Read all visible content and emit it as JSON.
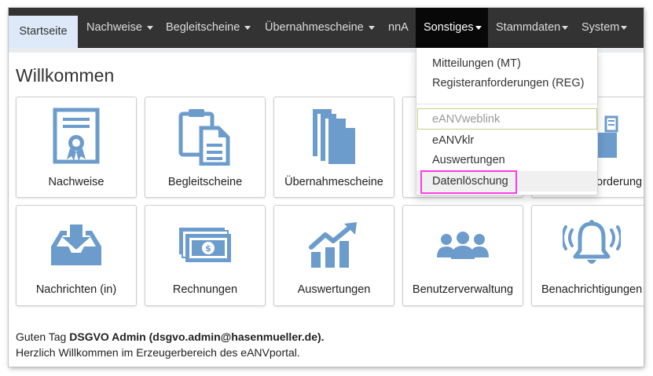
{
  "nav": {
    "items": [
      {
        "label": "Startseite",
        "caret": false
      },
      {
        "label": "Nachweise",
        "caret": true
      },
      {
        "label": "Begleitscheine",
        "caret": true
      },
      {
        "label": "Übernahmescheine",
        "caret": true
      },
      {
        "label": "nnA",
        "caret": false
      },
      {
        "label": "Sonstiges",
        "caret": true
      },
      {
        "label": "Stammdaten",
        "caret": true
      },
      {
        "label": "System",
        "caret": true
      }
    ]
  },
  "page": {
    "title": "Willkommen",
    "greeting_prefix": "Guten Tag ",
    "greeting_user": "DSGVO Admin (dsgvo.admin@hasenmueller.de).",
    "welcome_line": "Herzlich Willkommen im Erzeugerbereich des eANVportal."
  },
  "tiles": [
    {
      "label": "Nachweise",
      "icon": "certificate-icon"
    },
    {
      "label": "Begleitscheine",
      "icon": "clipboard-doc-icon"
    },
    {
      "label": "Übernahmescheine",
      "icon": "stacked-docs-icon"
    },
    {
      "label": "",
      "icon": "hidden-tile"
    },
    {
      "label": "forderung",
      "icon": "folder-icon"
    },
    {
      "label": "Nachrichten (in)",
      "icon": "inbox-download-icon"
    },
    {
      "label": "Rechnungen",
      "icon": "banknotes-icon"
    },
    {
      "label": "Auswertungen",
      "icon": "growth-chart-icon"
    },
    {
      "label": "Benutzerverwaltung",
      "icon": "users-icon"
    },
    {
      "label": "Benachrichtigungen",
      "icon": "bell-icon"
    }
  ],
  "dropdown": {
    "items": [
      {
        "label": "Mitteilungen (MT)"
      },
      {
        "label": "Registeranforderungen (REG)"
      },
      {
        "label": "eANVweblink"
      },
      {
        "label": "eANVklr"
      },
      {
        "label": "Auswertungen"
      },
      {
        "label": "Datenlöschung"
      }
    ]
  },
  "colors": {
    "navbar": "#333333",
    "active_tab": "#dde9f8",
    "icon_blue": "#6c9ccb",
    "highlight": "#ff3ae6"
  }
}
